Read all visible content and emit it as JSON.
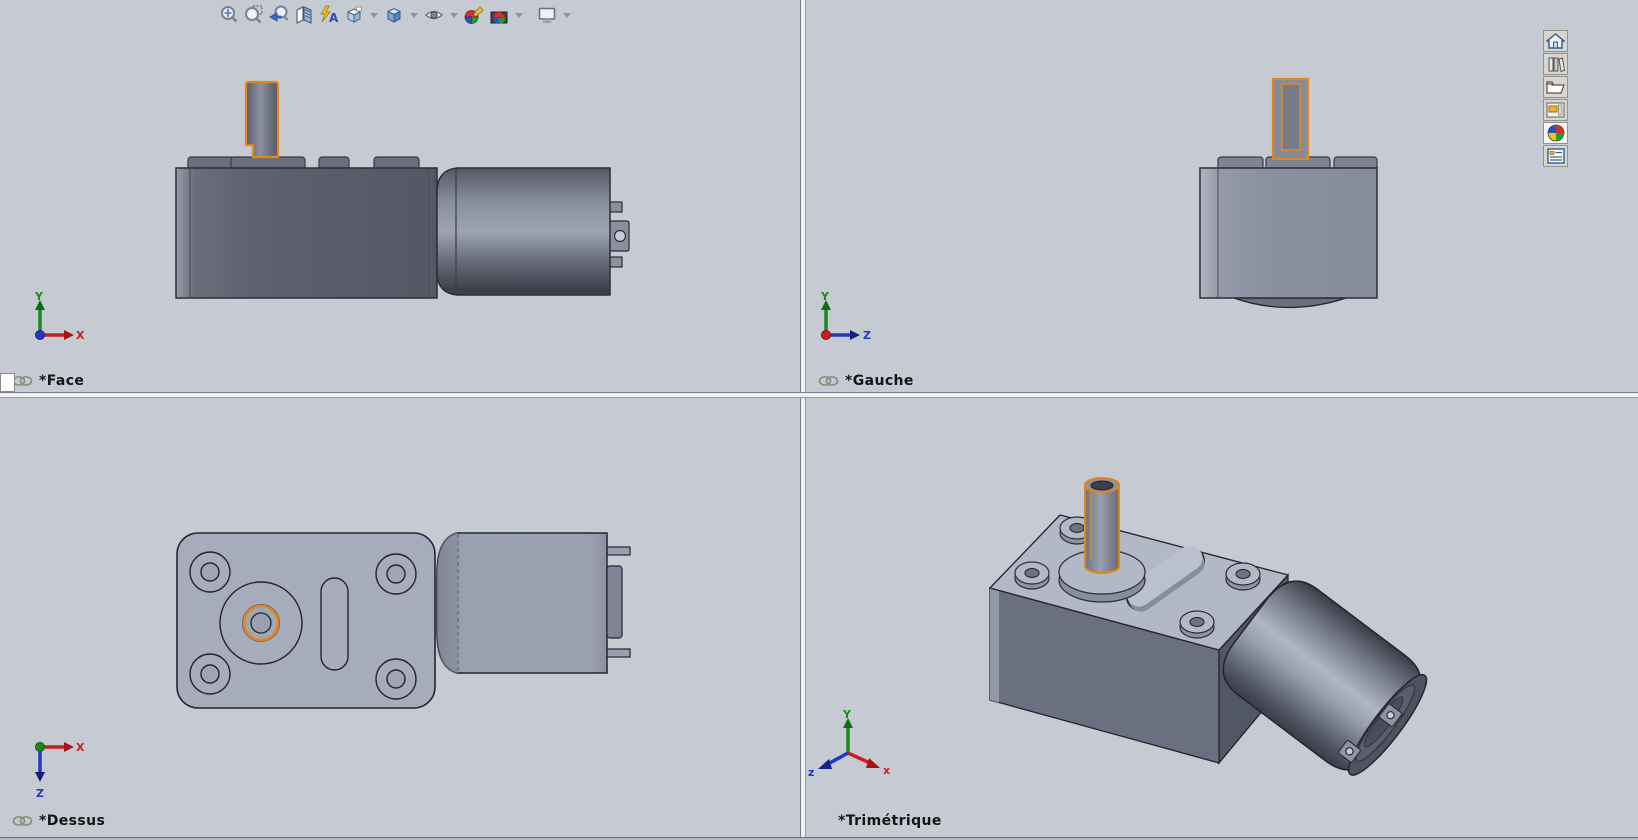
{
  "app": {
    "type": "cad-multi-viewport",
    "background_color": "#c6cad3",
    "selection_color": "#e0871c",
    "model_body_dark": "#5d6170",
    "model_body_light": "#a6acbb"
  },
  "toolbar": {
    "items": [
      {
        "icon": "zoom-to-fit",
        "has_dropdown": false
      },
      {
        "icon": "zoom-to-area",
        "has_dropdown": false
      },
      {
        "icon": "previous-view",
        "has_dropdown": false
      },
      {
        "icon": "section-view",
        "has_dropdown": false
      },
      {
        "icon": "annotation-views",
        "has_dropdown": false
      },
      {
        "icon": "view-orientation",
        "has_dropdown": true
      },
      {
        "icon": "display-style",
        "has_dropdown": true
      },
      {
        "icon": "hide-show-items",
        "has_dropdown": true
      },
      {
        "icon": "edit-appearance",
        "has_dropdown": false
      },
      {
        "icon": "apply-scene",
        "has_dropdown": true
      },
      {
        "icon": "view-settings",
        "has_dropdown": true
      }
    ]
  },
  "task_pane": {
    "items": [
      {
        "icon": "home"
      },
      {
        "icon": "design-library"
      },
      {
        "icon": "file-explorer"
      },
      {
        "icon": "view-palette"
      },
      {
        "icon": "appearances",
        "active": true
      },
      {
        "icon": "custom-properties"
      }
    ]
  },
  "viewports": [
    {
      "name": "face",
      "label": "*Face",
      "linked": true,
      "triad": {
        "up": "Y",
        "right": "X"
      }
    },
    {
      "name": "gauche",
      "label": "*Gauche",
      "linked": true,
      "triad": {
        "up": "Y",
        "right": "Z"
      }
    },
    {
      "name": "dessus",
      "label": "*Dessus",
      "linked": true,
      "triad": {
        "right": "X",
        "down": "Z"
      }
    },
    {
      "name": "trimetrique",
      "label": "*Trimétrique",
      "linked": false,
      "triad": {
        "up": "Y",
        "lower_right": "x",
        "lower_left": "z"
      }
    }
  ],
  "triad_colors": {
    "x_axis": "#c81e1e",
    "y_axis": "#1a8a1a",
    "z_axis": "#2236c8"
  }
}
